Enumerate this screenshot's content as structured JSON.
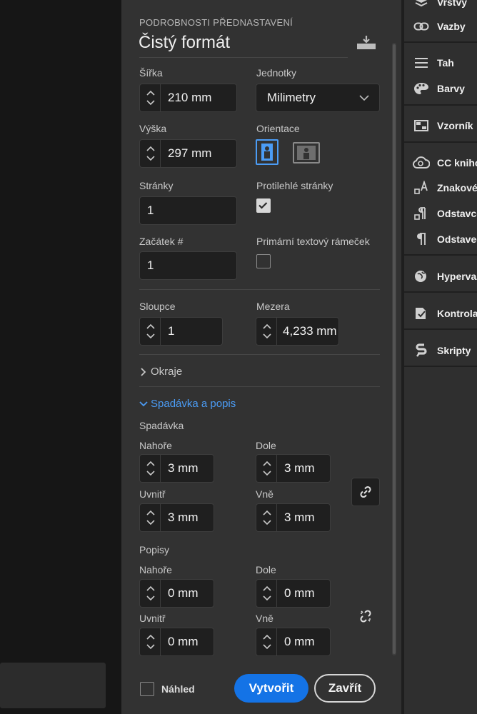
{
  "dialog": {
    "header": "PODROBNOSTI PŘEDNASTAVENÍ",
    "preset_name": "Čistý formát",
    "width_label": "Šířka",
    "width_value": "210 mm",
    "units_label": "Jednotky",
    "units_value": "Milimetry",
    "height_label": "Výška",
    "height_value": "297 mm",
    "orientation_label": "Orientace",
    "pages_label": "Stránky",
    "pages_value": "1",
    "facing_label": "Protilehlé stránky",
    "start_label": "Začátek #",
    "start_value": "1",
    "primary_frame_label": "Primární textový rámeček",
    "columns_label": "Sloupce",
    "columns_value": "1",
    "gutter_label": "Mezera",
    "gutter_value": "4,233 mm",
    "margins_label": "Okraje",
    "bleed_section_label": "Spadávka a popis",
    "bleed_label": "Spadávka",
    "bleed": {
      "top_label": "Nahoře",
      "top": "3 mm",
      "bottom_label": "Dole",
      "bottom": "3 mm",
      "inside_label": "Uvnitř",
      "inside": "3 mm",
      "outside_label": "Vně",
      "outside": "3 mm"
    },
    "slug_label": "Popisy",
    "slug": {
      "top_label": "Nahoře",
      "top": "0 mm",
      "bottom_label": "Dole",
      "bottom": "0 mm",
      "inside_label": "Uvnitř",
      "inside": "0 mm",
      "outside_label": "Vně",
      "outside": "0 mm"
    },
    "preview_label": "Náhled",
    "create_label": "Vytvořit",
    "close_label": "Zavřít"
  },
  "right_panel": {
    "items": [
      "Vrstvy",
      "Vazby",
      "Tah",
      "Barvy",
      "Vzorník",
      "CC knihovny",
      "Znakové",
      "Odstavcové",
      "Odstavec",
      "Hypervazby",
      "Kontrola",
      "Skripty"
    ]
  },
  "colors": {
    "accent": "#1473e6",
    "link": "#4b9cf5"
  }
}
